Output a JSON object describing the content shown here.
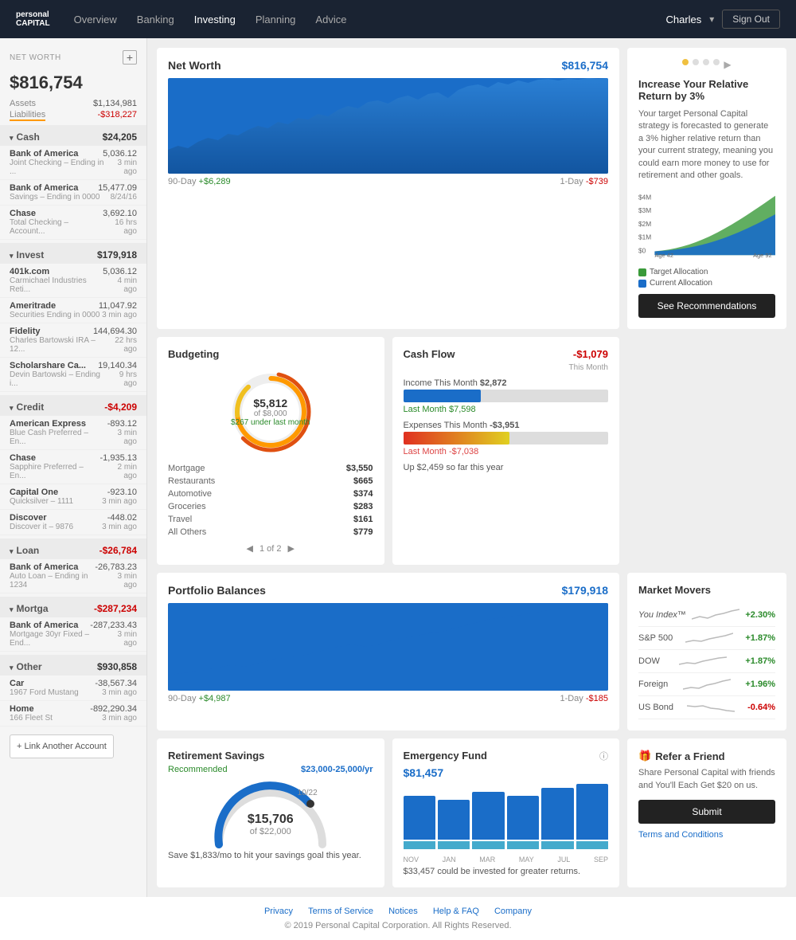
{
  "header": {
    "logo_line1": "personal",
    "logo_line2": "CAPITAL",
    "nav_items": [
      "Overview",
      "Banking",
      "Investing",
      "Planning",
      "Advice"
    ],
    "user": "Charles",
    "signout_label": "Sign Out"
  },
  "sidebar": {
    "title": "NET WORTH",
    "add_label": "+",
    "net_worth": "$816,754",
    "assets_label": "Assets",
    "assets_value": "$1,134,981",
    "liabilities_label": "Liabilities",
    "liabilities_value": "-$318,227",
    "sections": [
      {
        "name": "Cash",
        "total": "$24,205",
        "accounts": [
          {
            "name": "Bank of America",
            "sub": "Joint Checking – Ending in ...",
            "amount": "5,036.12",
            "time": "3 min ago"
          },
          {
            "name": "Bank of America",
            "sub": "Savings – Ending in 0000",
            "amount": "15,477.09",
            "time": "8/24/16"
          },
          {
            "name": "Chase",
            "sub": "Total Checking – Account...",
            "amount": "3,692.10",
            "time": "16 hrs ago"
          }
        ]
      },
      {
        "name": "Invest",
        "total": "$179,918",
        "accounts": [
          {
            "name": "401k.com",
            "sub": "Carmichael Industries Reti...",
            "amount": "5,036.12",
            "time": "4 min ago"
          },
          {
            "name": "Ameritrade",
            "sub": "Securities Ending in 0000",
            "amount": "11,047.92",
            "time": "3 min ago"
          },
          {
            "name": "Fidelity",
            "sub": "Charles Bartowski IRA – 12...",
            "amount": "144,694.30",
            "time": "22 hrs ago"
          },
          {
            "name": "Scholarshare Ca...",
            "sub": "Devin Bartowski – Ending i...",
            "amount": "19,140.34",
            "time": "9 hrs ago"
          }
        ]
      },
      {
        "name": "Credit",
        "total": "-$4,209",
        "negative": true,
        "accounts": [
          {
            "name": "American Express",
            "sub": "Blue Cash Preferred – En...",
            "amount": "-893.12",
            "time": "3 min ago"
          },
          {
            "name": "Chase",
            "sub": "Sapphire Preferred – En...",
            "amount": "-1,935.13",
            "time": "2 min ago"
          },
          {
            "name": "Capital One",
            "sub": "Quicksilver – 1111",
            "amount": "-923.10",
            "time": "3 min ago"
          },
          {
            "name": "Discover",
            "sub": "Discover it – 9876",
            "amount": "-448.02",
            "time": "3 min ago"
          }
        ]
      },
      {
        "name": "Loan",
        "total": "-$26,784",
        "negative": true,
        "accounts": [
          {
            "name": "Bank of America",
            "sub": "Auto Loan – Ending in 1234",
            "amount": "-26,783.23",
            "time": "3 min ago"
          }
        ]
      },
      {
        "name": "Mortga",
        "total": "-$287,234",
        "negative": true,
        "accounts": [
          {
            "name": "Bank of America",
            "sub": "Mortgage 30yr Fixed – End...",
            "amount": "-287,233.43",
            "time": "3 min ago"
          }
        ]
      },
      {
        "name": "Other",
        "total": "$930,858",
        "accounts": [
          {
            "name": "Car",
            "sub": "1967 Ford Mustang",
            "amount": "-38,567.34",
            "time": "3 min ago"
          },
          {
            "name": "Home",
            "sub": "166 Fleet St",
            "amount": "-892,290.34",
            "time": "3 min ago"
          }
        ]
      }
    ],
    "link_account_label": "+ Link Another Account"
  },
  "net_worth_card": {
    "title": "Net Worth",
    "value": "$816,754",
    "change_90": "+$6,289",
    "label_90": "90-Day",
    "change_1d": "-$739",
    "label_1d": "1-Day"
  },
  "recommendation_card": {
    "title": "Increase Your Relative Return by 3%",
    "text": "Your target Personal Capital strategy is forecasted to generate a 3% higher relative return than your current strategy, meaning you could earn more money to use for retirement and other goals.",
    "legend_target": "Target Allocation",
    "legend_current": "Current Allocation",
    "y_labels": [
      "$4M",
      "$3M",
      "$2M",
      "$1M",
      "$0"
    ],
    "x_labels": [
      "Age 42",
      "Age 92"
    ],
    "btn_label": "See Recommendations"
  },
  "budgeting_card": {
    "title": "Budgeting",
    "amount": "$5,812",
    "of_label": "of $8,000",
    "sub_label": "$267 under last month",
    "categories": [
      {
        "name": "Mortgage",
        "amount": "$3,550"
      },
      {
        "name": "Restaurants",
        "amount": "$665"
      },
      {
        "name": "Automotive",
        "amount": "$374"
      },
      {
        "name": "Groceries",
        "amount": "$283"
      },
      {
        "name": "Travel",
        "amount": "$161"
      },
      {
        "name": "All Others",
        "amount": "$779"
      }
    ],
    "page_label": "1 of 2"
  },
  "cashflow_card": {
    "title": "Cash Flow",
    "value": "-$1,079",
    "this_month": "This Month",
    "income_label": "Income This Month",
    "income_value": "$2,872",
    "income_pct": 38,
    "last_month_income": "Last Month $7,598",
    "expense_label": "Expenses This Month",
    "expense_value": "-$3,951",
    "expense_pct": 52,
    "last_month_expense": "Last Month -$7,038",
    "year_total": "Up $2,459 so far this year"
  },
  "portfolio_card": {
    "title": "Portfolio Balances",
    "value": "$179,918",
    "change_90": "+$4,987",
    "label_90": "90-Day",
    "change_1d": "-$185",
    "label_1d": "1-Day"
  },
  "market_movers": {
    "title": "Market Movers",
    "items": [
      {
        "name": "You Index™",
        "change": "+2.30%",
        "positive": true
      },
      {
        "name": "S&P 500",
        "change": "+1.87%",
        "positive": true
      },
      {
        "name": "DOW",
        "change": "+1.87%",
        "positive": true
      },
      {
        "name": "Foreign",
        "change": "+1.96%",
        "positive": true
      },
      {
        "name": "US Bond",
        "change": "-0.64%",
        "positive": false
      }
    ]
  },
  "retirement_card": {
    "title": "Retirement Savings",
    "recommended_label": "Recommended",
    "range_value": "$23,000-25,000/yr",
    "amount": "$15,706",
    "of_label": "of $22,000",
    "date_label": "10/22",
    "save_note": "Save $1,833/mo to hit your savings goal this year."
  },
  "emergency_fund_card": {
    "title": "Emergency Fund",
    "amount": "$81,457",
    "months": [
      "NOV",
      "JAN",
      "MAR",
      "MAY",
      "JUL",
      "SEP"
    ],
    "note": "$33,457 could be invested for greater returns."
  },
  "refer_card": {
    "title": "Refer a Friend",
    "icon": "gift-icon",
    "text": "Share Personal Capital with friends and You'll Each Get $20 on us.",
    "btn_label": "Submit",
    "terms_label": "Terms and Conditions"
  },
  "footer": {
    "links": [
      "Privacy",
      "Terms of Service",
      "Notices",
      "Help & FAQ",
      "Company"
    ],
    "copyright": "© 2019 Personal Capital Corporation. All Rights Reserved."
  }
}
